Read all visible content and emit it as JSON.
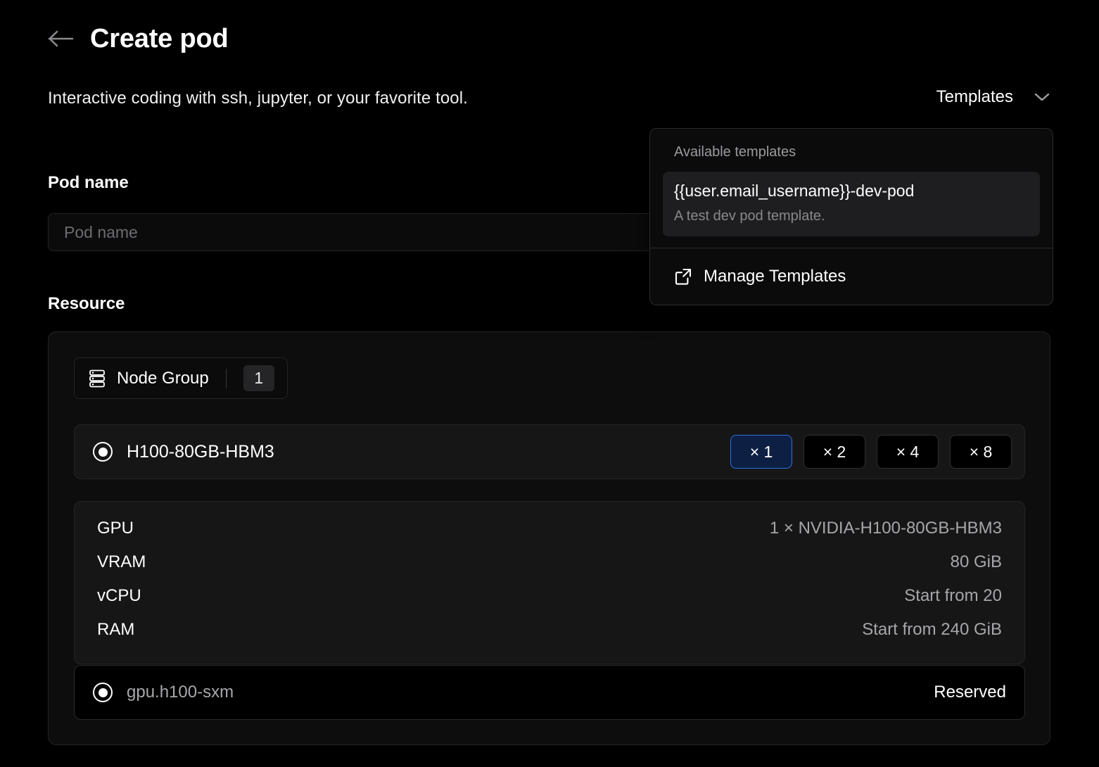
{
  "header": {
    "back_icon": "arrow-left-icon",
    "title": "Create pod",
    "subtitle": "Interactive coding with ssh, jupyter, or your favorite tool."
  },
  "templates": {
    "trigger_label": "Templates",
    "chevron_icon": "chevron-down-icon",
    "dropdown": {
      "heading": "Available templates",
      "items": [
        {
          "title": "{{user.email_username}}-dev-pod",
          "description": "A test dev pod template.",
          "selected": true
        }
      ],
      "footer": {
        "icon": "external-link-icon",
        "label": "Manage Templates"
      }
    }
  },
  "pod_name": {
    "label": "Pod name",
    "placeholder": "Pod name",
    "value": ""
  },
  "resource": {
    "label": "Resource",
    "node_group": {
      "icon": "server-stack-icon",
      "label": "Node Group",
      "count": "1"
    },
    "gpu_option": {
      "name": "H100-80GB-HBM3",
      "selected": true,
      "multipliers": [
        {
          "label": "× 1",
          "value": "1",
          "selected": true
        },
        {
          "label": "× 2",
          "value": "2",
          "selected": false
        },
        {
          "label": "× 4",
          "value": "4",
          "selected": false
        },
        {
          "label": "× 8",
          "value": "8",
          "selected": false
        }
      ]
    },
    "specs": [
      {
        "key": "GPU",
        "value": "1 × NVIDIA-H100-80GB-HBM3"
      },
      {
        "key": "VRAM",
        "value": "80 GiB"
      },
      {
        "key": "vCPU",
        "value": "Start from 20"
      },
      {
        "key": "RAM",
        "value": "Start from 240 GiB"
      }
    ],
    "instance": {
      "name": "gpu.h100-sxm",
      "status": "Reserved",
      "selected": true
    }
  },
  "colors": {
    "page_background": "#000000",
    "card_background": "#0d0d0e",
    "panel_background": "#161617",
    "border": "#242426",
    "accent_selected_border": "#2f6fe4",
    "accent_selected_fill": "#0d1f42",
    "muted_text": "#a7a7ab"
  }
}
